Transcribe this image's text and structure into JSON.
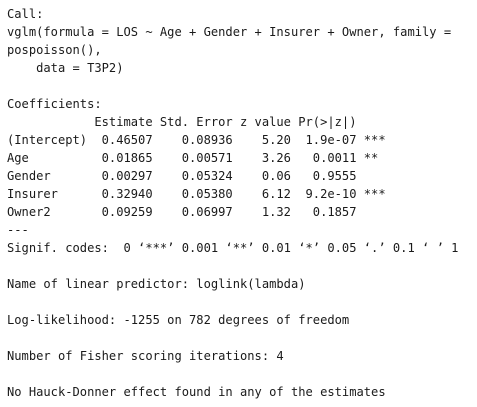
{
  "lines": [
    "Call:",
    "vglm(formula = LOS ~ Age + Gender + Insurer + Owner, family =",
    "pospoisson(),",
    "    data = T3P2)",
    "",
    "Coefficients:",
    "            Estimate Std. Error z value Pr(>|z|)    ",
    "(Intercept)  0.46507    0.08936    5.20  1.9e-07 ***",
    "Age          0.01865    0.00571    3.26   0.0011 ** ",
    "Gender       0.00297    0.05324    0.06   0.9555    ",
    "Insurer      0.32940    0.05380    6.12  9.2e-10 ***",
    "Owner2       0.09259    0.06997    1.32   0.1857    ",
    "---",
    "Signif. codes:  0 ‘***’ 0.001 ‘**’ 0.01 ‘*’ 0.05 ‘.’ 0.1 ‘ ’ 1",
    "",
    "Name of linear predictor: loglink(lambda)",
    "",
    "Log-likelihood: -1255 on 782 degrees of freedom",
    "",
    "Number of Fisher scoring iterations: 4",
    "",
    "No Hauck-Donner effect found in any of the estimates"
  ]
}
